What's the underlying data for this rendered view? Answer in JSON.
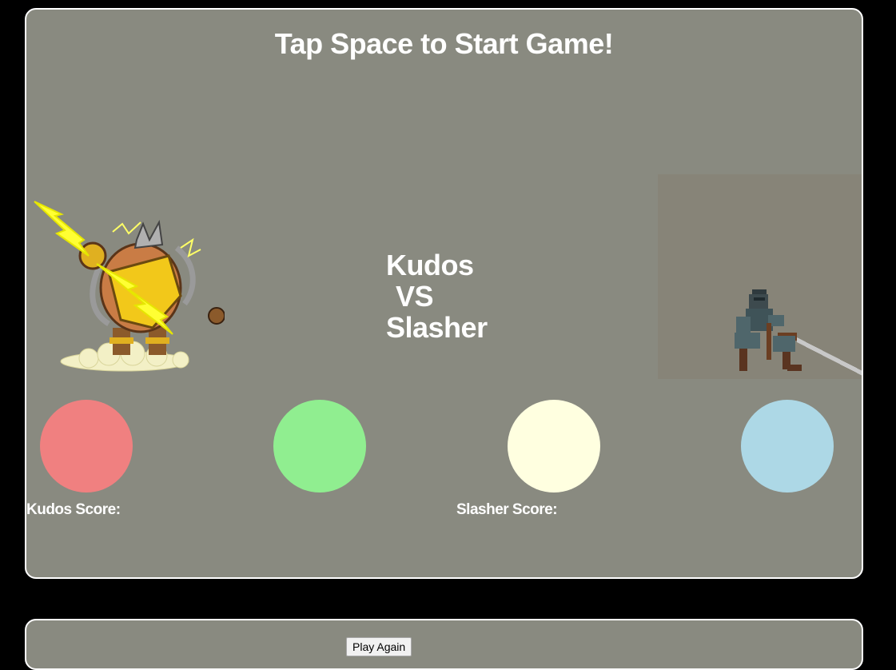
{
  "game": {
    "title": "Tap Space to Start Game!",
    "versus": {
      "player1": "Kudos",
      "vs": "VS",
      "player2": "Slasher"
    },
    "pads": [
      {
        "name": "red-pad",
        "color": "#f08080"
      },
      {
        "name": "green-pad",
        "color": "#90ee90"
      },
      {
        "name": "yellow-pad",
        "color": "#ffffe0"
      },
      {
        "name": "blue-pad",
        "color": "#add8e6"
      }
    ],
    "scores": {
      "kudos_label": "Kudos Score:",
      "kudos_value": "",
      "slasher_label": "Slasher Score:",
      "slasher_value": ""
    },
    "characters": {
      "kudos_icon": "lightning-warrior-sprite",
      "slasher_icon": "pixel-ninja-sprite"
    }
  },
  "controls": {
    "play_again_label": "Play Again"
  }
}
